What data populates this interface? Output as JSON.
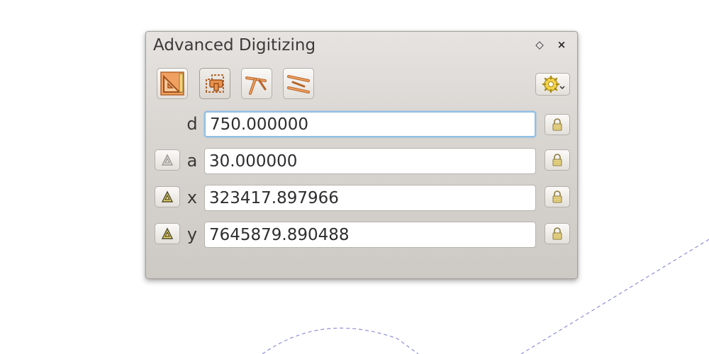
{
  "panel": {
    "title": "Advanced Digitizing",
    "float_icon": "float-icon",
    "close_icon": "close-icon"
  },
  "toolbar": {
    "tools": [
      {
        "icon": "cad-enable-icon",
        "active": false
      },
      {
        "icon": "construction-mode-icon",
        "active": true
      },
      {
        "icon": "perpendicular-icon",
        "active": false
      },
      {
        "icon": "parallel-icon",
        "active": false
      }
    ],
    "settings_icon": "settings-gear-icon"
  },
  "fields": {
    "d": {
      "label": "d",
      "value": "750.000000",
      "focused": true
    },
    "a": {
      "label": "a",
      "value": "30.000000"
    },
    "x": {
      "label": "x",
      "value": "323417.897966"
    },
    "y": {
      "label": "y",
      "value": "7645879.890488"
    }
  },
  "colors": {
    "lock_yellow": "#e8d68a",
    "tool_orange": "#e8924a",
    "focus_blue": "#8ec0e6",
    "guide_line": "#8f8fd6"
  }
}
